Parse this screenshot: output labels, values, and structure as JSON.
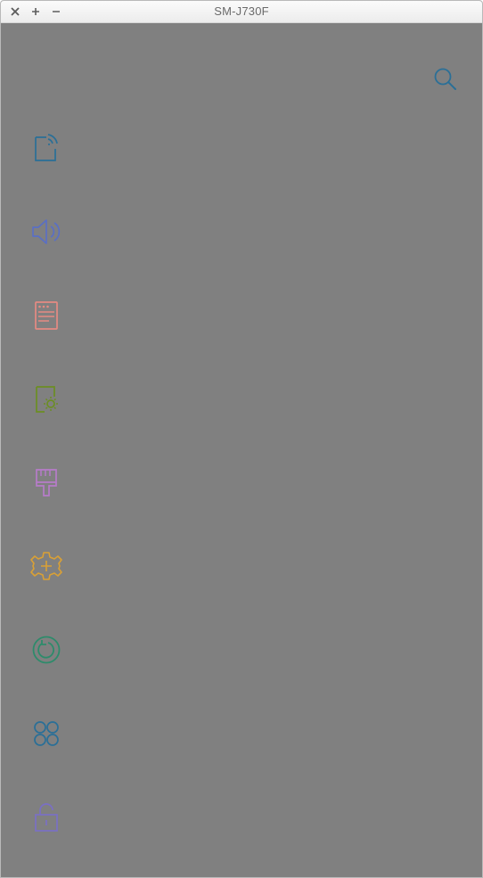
{
  "window": {
    "title": "SM-J730F",
    "controls": {
      "close_icon": "close-icon",
      "maximize_icon": "plus-icon",
      "minimize_icon": "minus-icon"
    }
  },
  "header": {
    "search_icon": "search-icon",
    "search_color": "#2a6f97"
  },
  "settings_list": [
    {
      "icon": "connections-icon",
      "color": "#2a6f97"
    },
    {
      "icon": "sound-icon",
      "color": "#5a6fc4"
    },
    {
      "icon": "notifications-icon",
      "color": "#e58a82"
    },
    {
      "icon": "display-icon",
      "color": "#6b8e23"
    },
    {
      "icon": "wallpapers-themes-icon",
      "color": "#b67bc9"
    },
    {
      "icon": "advanced-features-icon",
      "color": "#d9a035"
    },
    {
      "icon": "device-maintenance-icon",
      "color": "#2e8b6b"
    },
    {
      "icon": "apps-icon",
      "color": "#2a6f97"
    },
    {
      "icon": "lock-screen-security-icon",
      "color": "#7a6fc4"
    }
  ],
  "overlay_color": "#808080"
}
